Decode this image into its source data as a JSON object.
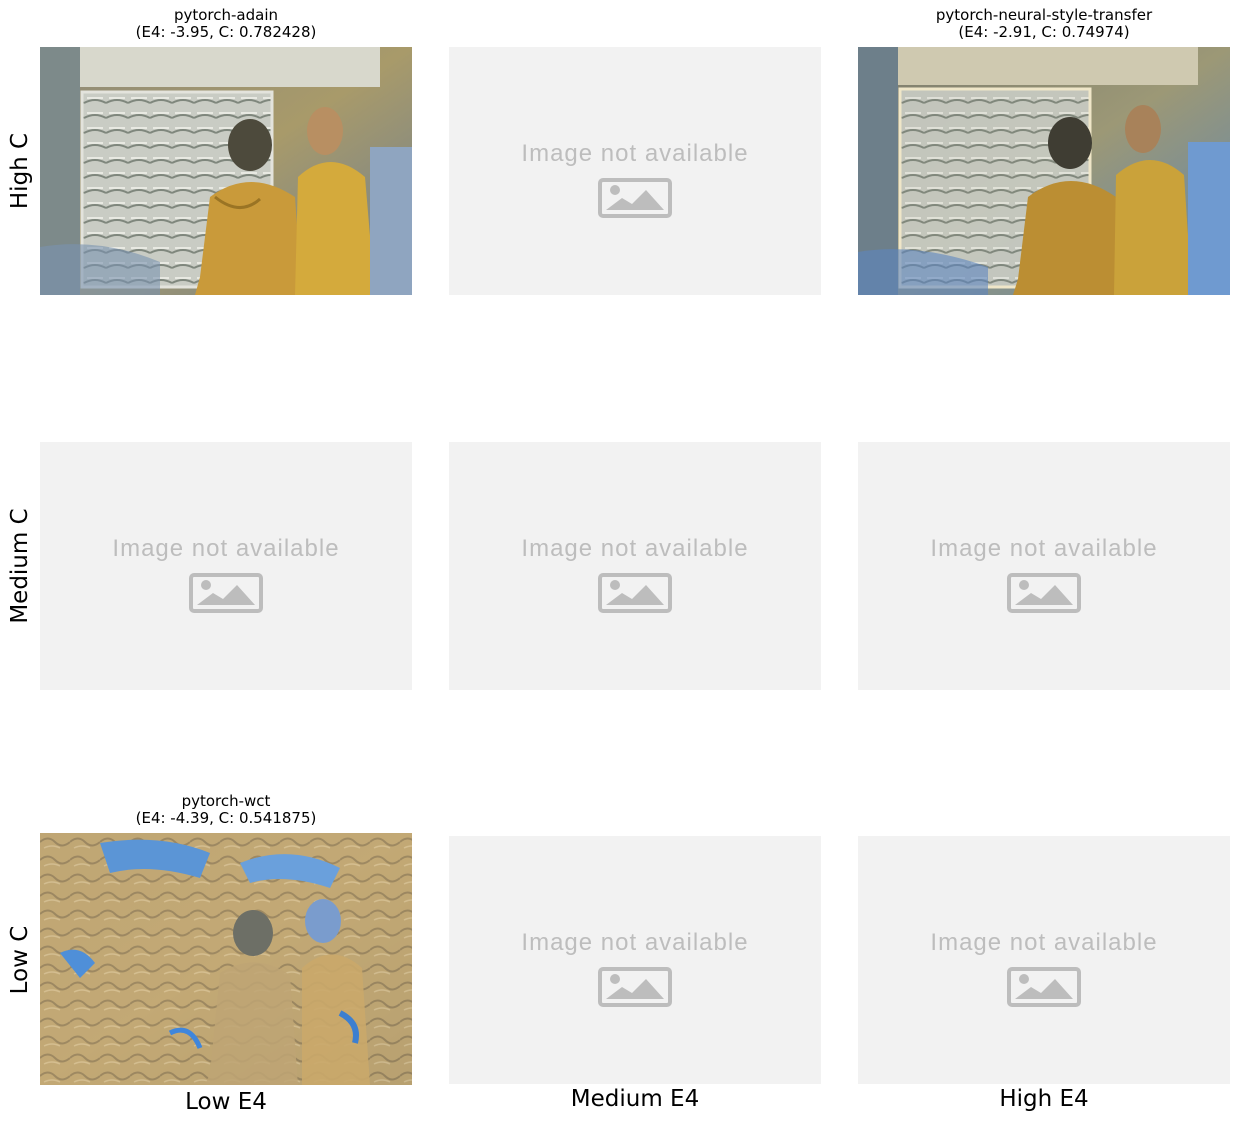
{
  "rows": [
    {
      "label": "High C"
    },
    {
      "label": "Medium C"
    },
    {
      "label": "Low C"
    }
  ],
  "columns": [
    {
      "label": "Low E4"
    },
    {
      "label": "Medium E4"
    },
    {
      "label": "High E4"
    }
  ],
  "placeholder_text": "Image not available",
  "cells": {
    "high_low": {
      "method": "pytorch-adain",
      "metrics": "(E4: -3.95, C: 0.782428)",
      "E4": -3.95,
      "C": 0.782428
    },
    "high_high": {
      "method": "pytorch-neural-style-transfer",
      "metrics": "(E4: -2.91, C: 0.74974)",
      "E4": -2.91,
      "C": 0.74974
    },
    "low_low": {
      "method": "pytorch-wct",
      "metrics": "(E4: -4.39, C: 0.541875)",
      "E4": -4.39,
      "C": 0.541875
    }
  },
  "icons": {
    "placeholder": "image-placeholder-icon"
  },
  "colors": {
    "placeholder_bg": "#f2f2f2",
    "placeholder_fg": "#bdbdbd"
  }
}
